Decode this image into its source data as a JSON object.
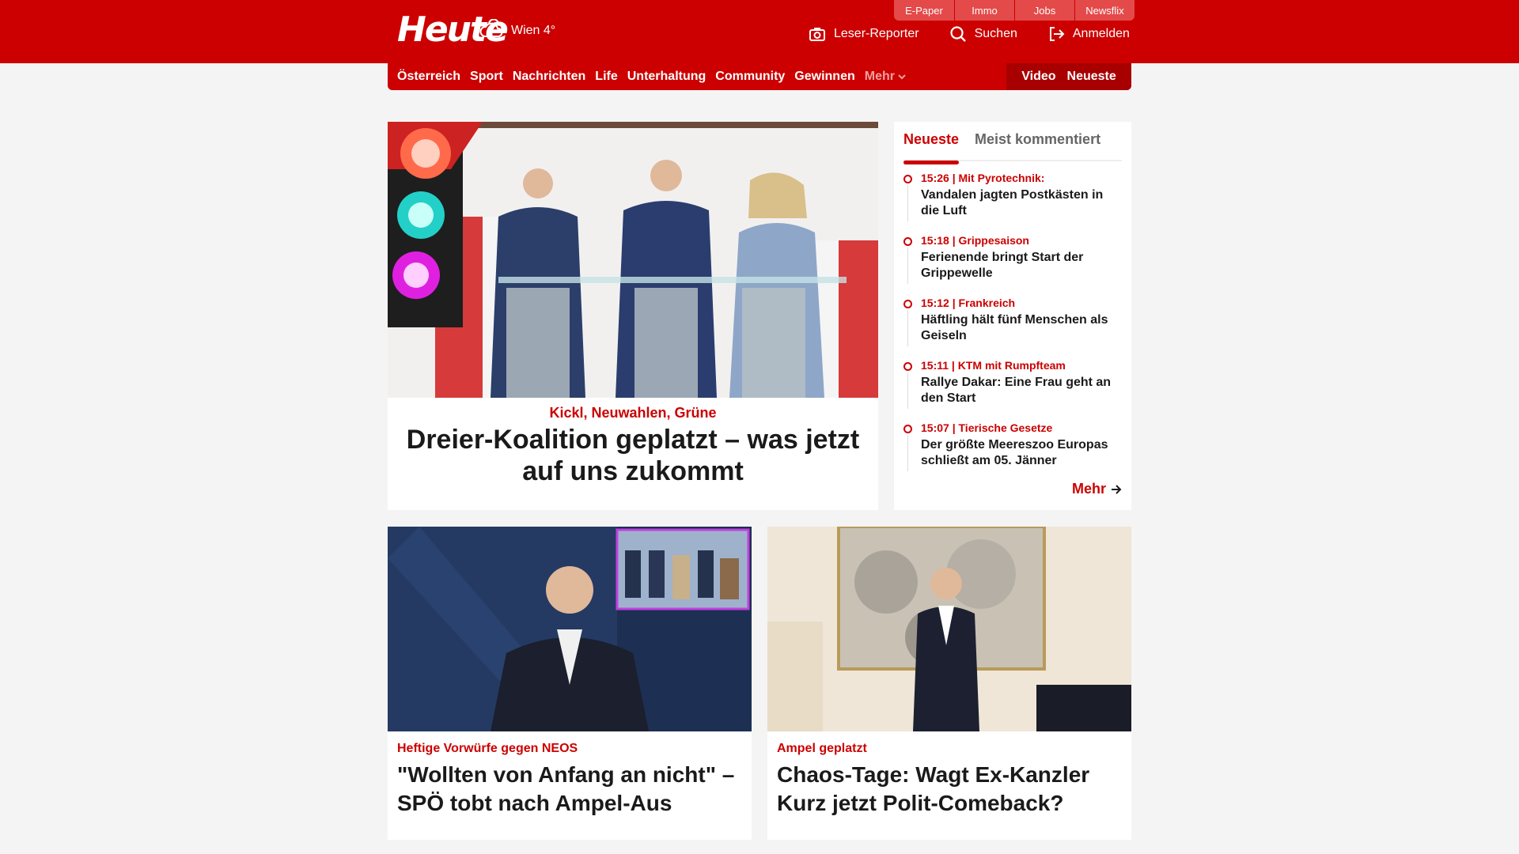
{
  "header": {
    "logo": "Heute",
    "weather": "Wien 4°",
    "service_tabs": [
      "E-Paper",
      "Immo",
      "Jobs",
      "Newsflix"
    ],
    "actions": [
      {
        "label": "Leser-Reporter",
        "icon": "camera-icon"
      },
      {
        "label": "Suchen",
        "icon": "search-icon"
      },
      {
        "label": "Anmelden",
        "icon": "login-icon"
      }
    ]
  },
  "nav": {
    "items": [
      "Österreich",
      "Sport",
      "Nachrichten",
      "Life",
      "Unterhaltung",
      "Community",
      "Gewinnen"
    ],
    "more": "Mehr",
    "right": [
      "Video",
      "Neueste"
    ]
  },
  "lead": {
    "kicker": "Kickl, Neuwahlen, Grüne",
    "title": "Dreier-Koalition geplatzt – was jetzt auf uns zukommt"
  },
  "sidebar": {
    "tabs": [
      "Neueste",
      "Meist kommentiert"
    ],
    "items": [
      {
        "meta": "15:26 | Mit Pyrotechnik:",
        "title": "Vandalen jagten Postkästen in die Luft"
      },
      {
        "meta": "15:18 | Grippesaison",
        "title": "Ferienende bringt Start der Grippewelle"
      },
      {
        "meta": "15:12 | Frankreich",
        "title": "Häftling hält fünf Menschen als Geiseln"
      },
      {
        "meta": "15:11 | KTM mit Rumpfteam",
        "title": "Rallye Dakar: Eine Frau geht an den Start"
      },
      {
        "meta": "15:07 | Tierische Gesetze",
        "title": "Der größte Meereszoo Europas schließt am 05. Jänner"
      }
    ],
    "more": "Mehr"
  },
  "cards": [
    {
      "kicker": "Heftige Vorwürfe gegen NEOS",
      "title": "\"Wollten von Anfang an nicht\" – SPÖ tobt nach Ampel-Aus"
    },
    {
      "kicker": "Ampel geplatzt",
      "title": "Chaos-Tage: Wagt Ex-Kanzler Kurz jetzt Polit-Comeback?"
    }
  ],
  "colors": {
    "brand_red": "#cc0000",
    "background": "#f4f4f4"
  }
}
